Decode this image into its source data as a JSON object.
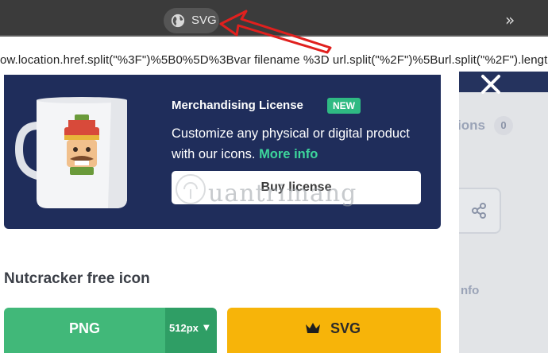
{
  "browser": {
    "svg_chip_label": "SVG",
    "more_chevron": "»",
    "url_text": "ow.location.href.split(\"%3F\")%5B0%5D%3Bvar filename %3D url.split(\"%2F\")%5Burl.split(\"%2F\").length-"
  },
  "license": {
    "title": "Merchandising License",
    "badge": "NEW",
    "description": "Customize any physical or digital product with our icons.",
    "more_info": "More info",
    "buy_label": "Buy license"
  },
  "background": {
    "tab_fragment": "ions",
    "tab_count": "0",
    "info_fragment": "nfo"
  },
  "watermark": "uantrimang",
  "icon": {
    "title": "Nutcracker free icon",
    "png_label": "PNG",
    "size_label": "512px",
    "svg_label": "SVG"
  },
  "colors": {
    "banner": "#1f2d5b",
    "new_badge": "#2fba83",
    "more_info": "#3dd69c",
    "png_button": "#41b879",
    "svg_button": "#f7b409",
    "annotation_arrow": "#e0201e"
  },
  "icons": [
    "globe-icon",
    "chevron-double-right-icon",
    "close-icon",
    "share-icon",
    "crown-icon",
    "caret-down-icon",
    "mug-nutcracker-illustration"
  ]
}
